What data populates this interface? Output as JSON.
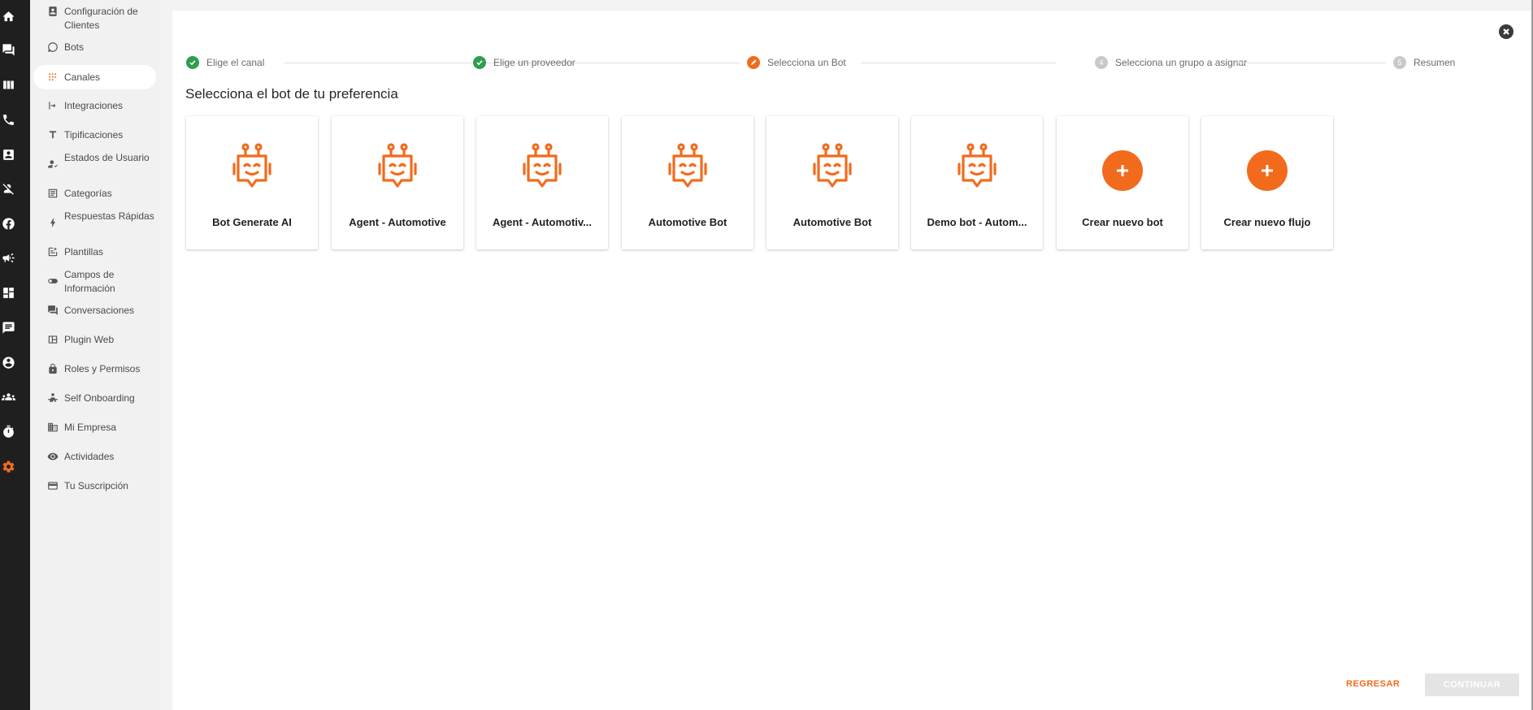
{
  "rail": {
    "icons": [
      "home-icon",
      "chat-icon",
      "board-icon",
      "phone-icon",
      "contact-icon",
      "block-user-icon",
      "facebook-icon",
      "campaign-icon",
      "dashboard-icon",
      "comment-icon",
      "account-icon",
      "group-icon",
      "timer-icon",
      "gear-icon"
    ],
    "active": "gear-icon",
    "active_color": "#f26b1d"
  },
  "sidebar": {
    "items": [
      {
        "label": "Configuración de Clientes",
        "icon": "contact-book-icon"
      },
      {
        "label": "Bots",
        "icon": "bot-bubble-icon"
      },
      {
        "label": "Canales",
        "icon": "channels-icon",
        "active": true
      },
      {
        "label": "Integraciones",
        "icon": "integrations-icon"
      },
      {
        "label": "Tipificaciones",
        "icon": "text-type-icon"
      },
      {
        "label": "Estados de Usuario",
        "icon": "user-status-icon"
      },
      {
        "label": "Categorías",
        "icon": "categories-icon"
      },
      {
        "label": "Respuestas Rápidas",
        "icon": "bolt-icon"
      },
      {
        "label": "Plantillas",
        "icon": "template-icon"
      },
      {
        "label": "Campos de Información",
        "icon": "toggle-icon"
      },
      {
        "label": "Conversaciones",
        "icon": "forum-icon"
      },
      {
        "label": "Plugin Web",
        "icon": "web-plugin-icon"
      },
      {
        "label": "Roles y Permisos",
        "icon": "lock-icon"
      },
      {
        "label": "Self Onboarding",
        "icon": "onboarding-icon"
      },
      {
        "label": "Mi Empresa",
        "icon": "building-icon"
      },
      {
        "label": "Actividades",
        "icon": "eye-icon"
      },
      {
        "label": "Tu Suscripción",
        "icon": "credit-card-icon"
      }
    ]
  },
  "stepper": {
    "steps": [
      {
        "label": "Elige el canal",
        "status": "done"
      },
      {
        "label": "Elige un proveedor",
        "status": "done"
      },
      {
        "label": "Selecciona un Bot",
        "status": "current"
      },
      {
        "label": "Selecciona un grupo a asignar",
        "status": "pending",
        "number": "4"
      },
      {
        "label": "Resumen",
        "status": "pending",
        "number": "5"
      }
    ]
  },
  "heading": "Selecciona el bot de tu preferencia",
  "cards": [
    {
      "label": "Bot Generate AI",
      "type": "bot"
    },
    {
      "label": "Agent - Automotive",
      "type": "bot"
    },
    {
      "label": "Agent - Automotiv...",
      "type": "bot"
    },
    {
      "label": "Automotive Bot",
      "type": "bot"
    },
    {
      "label": "Automotive Bot",
      "type": "bot"
    },
    {
      "label": "Demo bot - Autom...",
      "type": "bot"
    },
    {
      "label": "Crear nuevo bot",
      "type": "add"
    },
    {
      "label": "Crear nuevo flujo",
      "type": "add"
    }
  ],
  "footer": {
    "back_label": "REGRESAR",
    "continue_label": "CONTINUAR"
  },
  "colors": {
    "accent": "#f26b1d",
    "done": "#2e9e4e",
    "pending": "#c9c9c9"
  }
}
